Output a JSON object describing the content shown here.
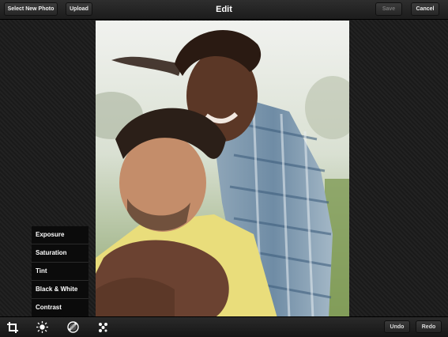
{
  "header": {
    "title": "Edit",
    "select_photo_label": "Select New Photo",
    "upload_label": "Upload",
    "save_label": "Save",
    "cancel_label": "Cancel"
  },
  "adjust_menu": {
    "items": [
      "Exposure",
      "Saturation",
      "Tint",
      "Black & White",
      "Contrast"
    ]
  },
  "toolbar": {
    "icons": [
      "crop-icon",
      "brightness-icon",
      "filter-icon",
      "effects-icon"
    ],
    "undo_label": "Undo",
    "redo_label": "Redo"
  },
  "colors": {
    "bar": "#222222",
    "menu_bg": "#0b0b0b",
    "text": "#ffffff"
  }
}
